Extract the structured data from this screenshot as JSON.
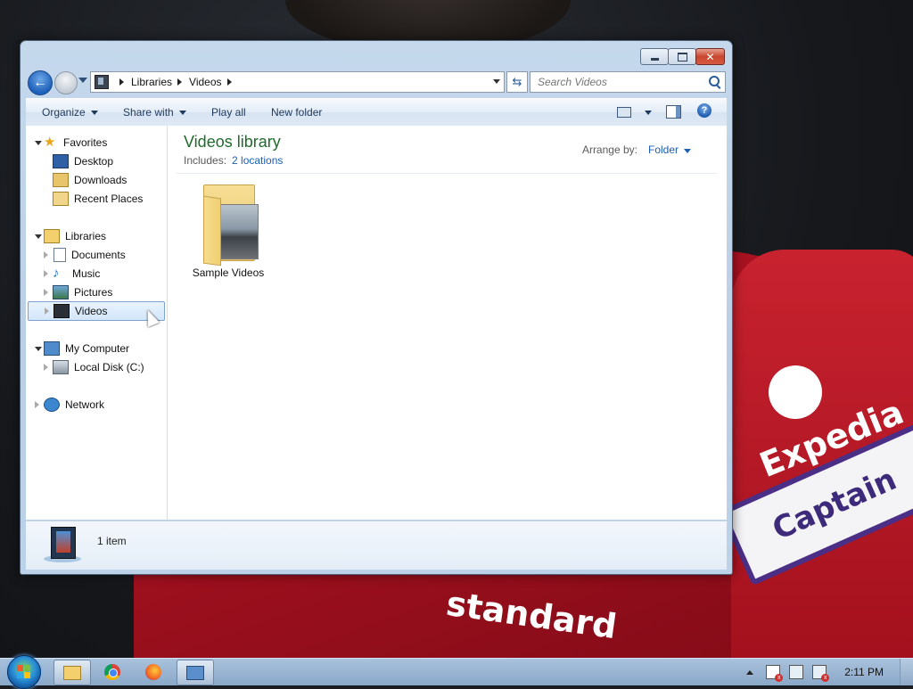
{
  "wallpaper": {
    "sponsor_text": "Expedia",
    "armband_text": "Captain",
    "chest_text": "standard"
  },
  "window": {
    "nav": {
      "breadcrumbs": [
        "Libraries",
        "Videos"
      ],
      "search_placeholder": "Search Videos"
    },
    "command_bar": {
      "organize": "Organize",
      "share_with": "Share with",
      "play_all": "Play all",
      "new_folder": "New folder"
    },
    "nav_pane": {
      "favorites": {
        "label": "Favorites",
        "items": [
          "Desktop",
          "Downloads",
          "Recent Places"
        ]
      },
      "libraries": {
        "label": "Libraries",
        "items": [
          "Documents",
          "Music",
          "Pictures",
          "Videos"
        ],
        "selected": "Videos"
      },
      "computer": {
        "label": "My Computer",
        "items": [
          "Local Disk (C:)"
        ]
      },
      "network": {
        "label": "Network"
      }
    },
    "content": {
      "title": "Videos library",
      "includes_label": "Includes:",
      "includes_link": "2 locations",
      "arrange_label": "Arrange by:",
      "arrange_value": "Folder",
      "items": [
        {
          "name": "Sample Videos",
          "icon": "video-folder-icon"
        }
      ]
    },
    "details": {
      "count": "1 item"
    }
  },
  "taskbar": {
    "pinned": [
      "folder-icon",
      "chrome-icon",
      "firefox-icon",
      "remote-desktop-icon"
    ],
    "clock": "2:11 PM"
  }
}
